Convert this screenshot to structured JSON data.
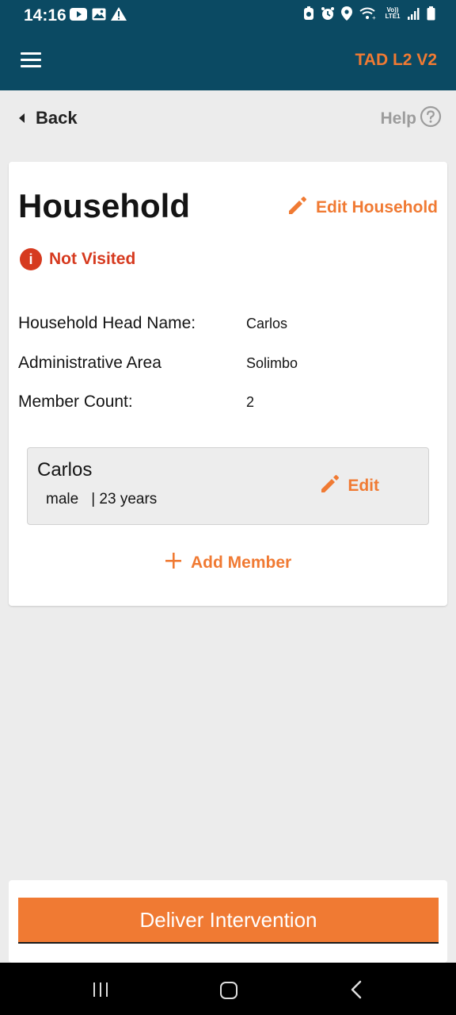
{
  "status_bar": {
    "time": "14:16",
    "left_icons": [
      "youtube-icon",
      "image-icon",
      "warning-icon"
    ],
    "right_icons": [
      "alarm-icon",
      "clock-icon",
      "location-icon",
      "wifi-icon",
      "volte-icon",
      "signal-icon",
      "battery-icon"
    ],
    "network_label": "Vo)) LTE1"
  },
  "appbar": {
    "title": "TAD L2 V2"
  },
  "nav": {
    "back_label": "Back",
    "help_label": "Help"
  },
  "household": {
    "title": "Household",
    "edit_label": "Edit Household",
    "status": "Not Visited",
    "fields": [
      {
        "label": "Household Head Name:",
        "value": "Carlos"
      },
      {
        "label": "Administrative Area",
        "value": "Solimbo"
      },
      {
        "label": "Member Count:",
        "value": "2"
      }
    ],
    "members": [
      {
        "name": "Carlos",
        "sex": "male",
        "age": "| 23 years",
        "edit_label": "Edit"
      }
    ],
    "add_member_label": "Add Member"
  },
  "footer": {
    "deliver_label": "Deliver Intervention"
  },
  "colors": {
    "primary": "#0b4a63",
    "accent": "#f07a33",
    "danger": "#d63a1f"
  }
}
